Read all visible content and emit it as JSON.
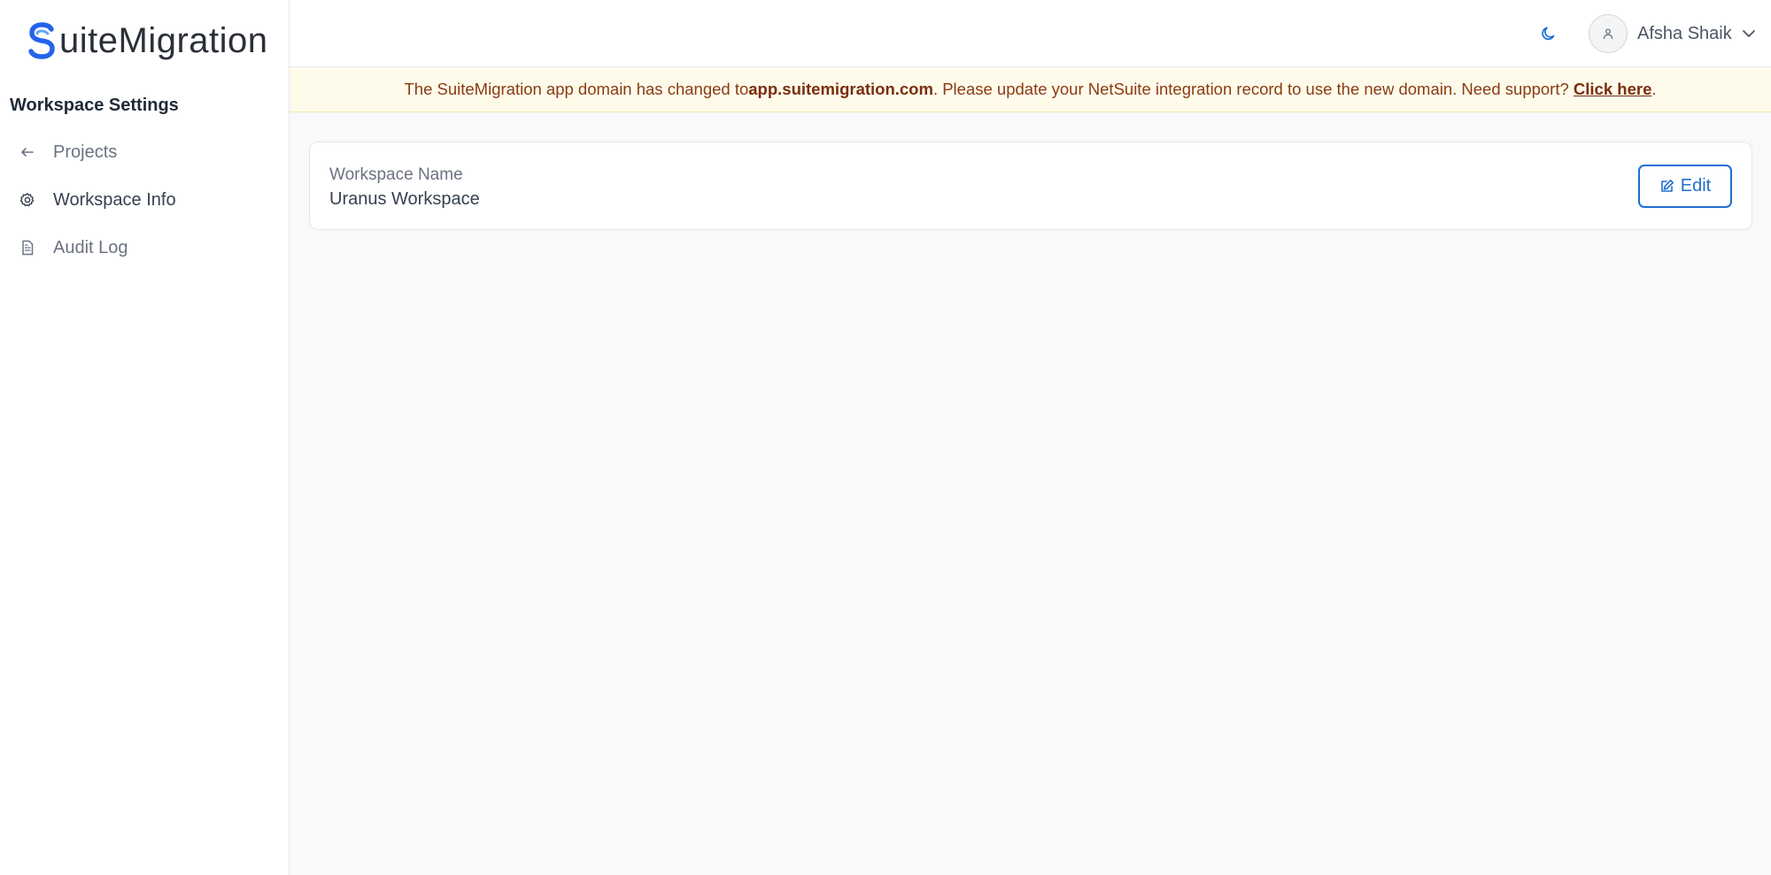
{
  "app": {
    "logo_text": "uiteMigration",
    "brand_color": "#2563eb"
  },
  "sidebar": {
    "section_title": "Workspace Settings",
    "items": [
      {
        "label": "Projects",
        "icon": "arrow-left-icon",
        "active": false
      },
      {
        "label": "Workspace Info",
        "icon": "gear-icon",
        "active": true
      },
      {
        "label": "Audit Log",
        "icon": "document-icon",
        "active": false
      }
    ]
  },
  "header": {
    "theme_icon": "moon-icon",
    "user_name": "Afsha Shaik",
    "avatar_icon": "user-icon"
  },
  "banner": {
    "text_before": "The SuiteMigration app domain has changed to ",
    "domain": "app.suitemigration.com",
    "text_middle": ". Please update your NetSuite integration record to use the new domain. Need support? ",
    "link_label": "Click here",
    "text_after": ".",
    "background": "#fefbeb",
    "text_color": "#8a3b12"
  },
  "workspace": {
    "field_label": "Workspace Name",
    "field_value": "Uranus Workspace",
    "edit_label": "Edit"
  }
}
